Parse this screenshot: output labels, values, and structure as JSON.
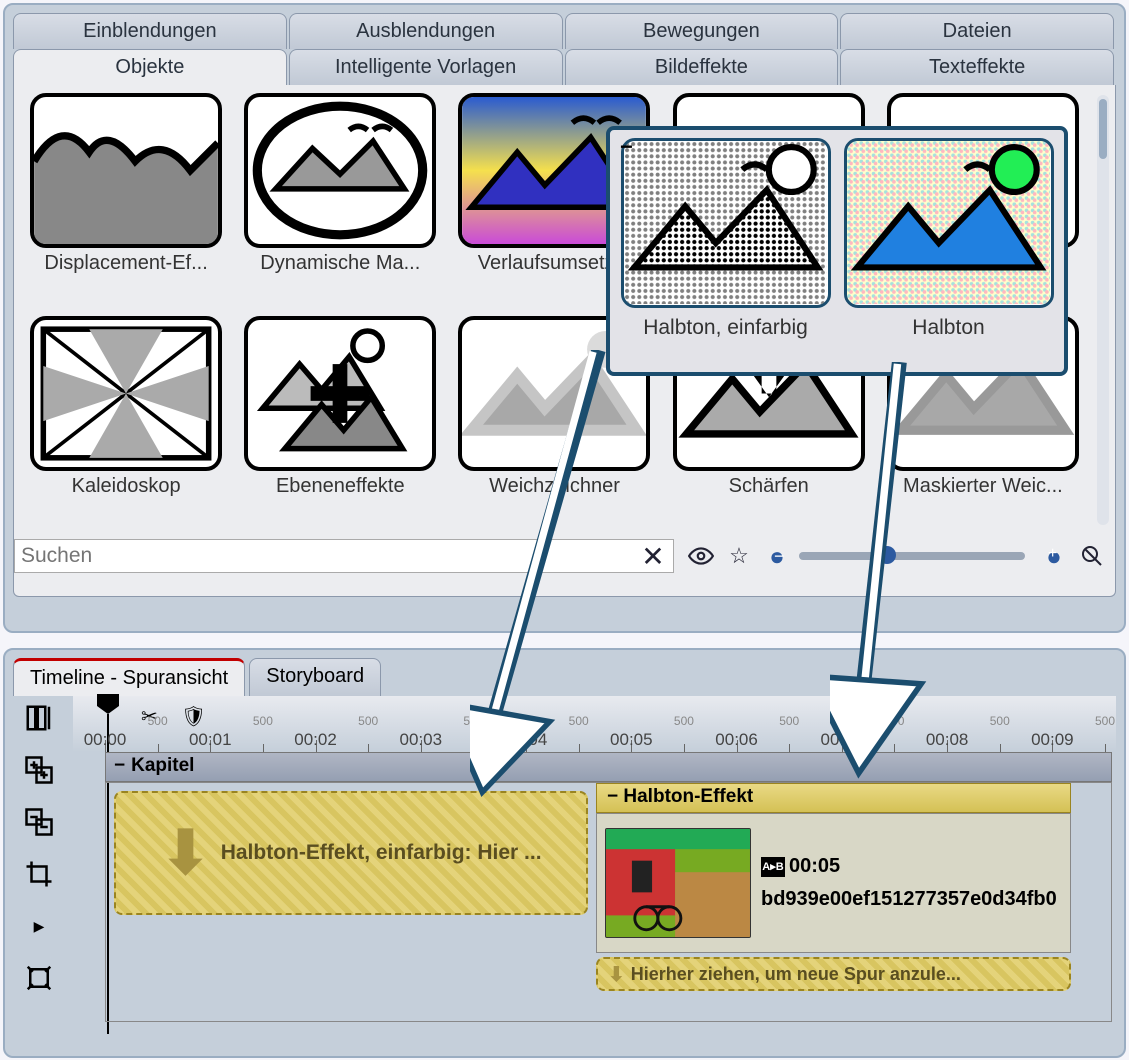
{
  "tabs_top": [
    "Einblendungen",
    "Ausblendungen",
    "Bewegungen",
    "Dateien"
  ],
  "tabs_bottom": [
    "Objekte",
    "Intelligente Vorlagen",
    "Bildeffekte",
    "Texteffekte"
  ],
  "active_tab": "Objekte",
  "gallery": [
    {
      "label": "Displacement-Ef..."
    },
    {
      "label": "Dynamische Ma..."
    },
    {
      "label": "Verlaufsumsetz..."
    },
    {
      "label": ""
    },
    {
      "label": ""
    },
    {
      "label": "Kaleidoskop"
    },
    {
      "label": "Ebeneneffekte"
    },
    {
      "label": "Weichzeichner"
    },
    {
      "label": "Schärfen"
    },
    {
      "label": "Maskierter Weic..."
    }
  ],
  "search": {
    "placeholder": "Suchen"
  },
  "popup": {
    "items": [
      {
        "label": "Halbton, einfarbig"
      },
      {
        "label": "Halbton"
      }
    ]
  },
  "timeline": {
    "tabs": [
      "Timeline - Spuransicht",
      "Storyboard"
    ],
    "active": "Timeline - Spuransicht",
    "marks": [
      "00:00",
      "00:01",
      "00:02",
      "00:03",
      "00:04",
      "00:05",
      "00:06",
      "00:07",
      "00:08",
      "00:09"
    ],
    "mark500": "500",
    "kapitel_title": "Kapitel",
    "drop_text": "Halbton-Effekt, einfarbig: Hier ...",
    "effect_title": "Halbton-Effekt",
    "clip_time": "00:05",
    "clip_name": "bd939e00ef151277357e0d34fb0",
    "new_track_text": "Hierher ziehen, um neue Spur anzule..."
  }
}
